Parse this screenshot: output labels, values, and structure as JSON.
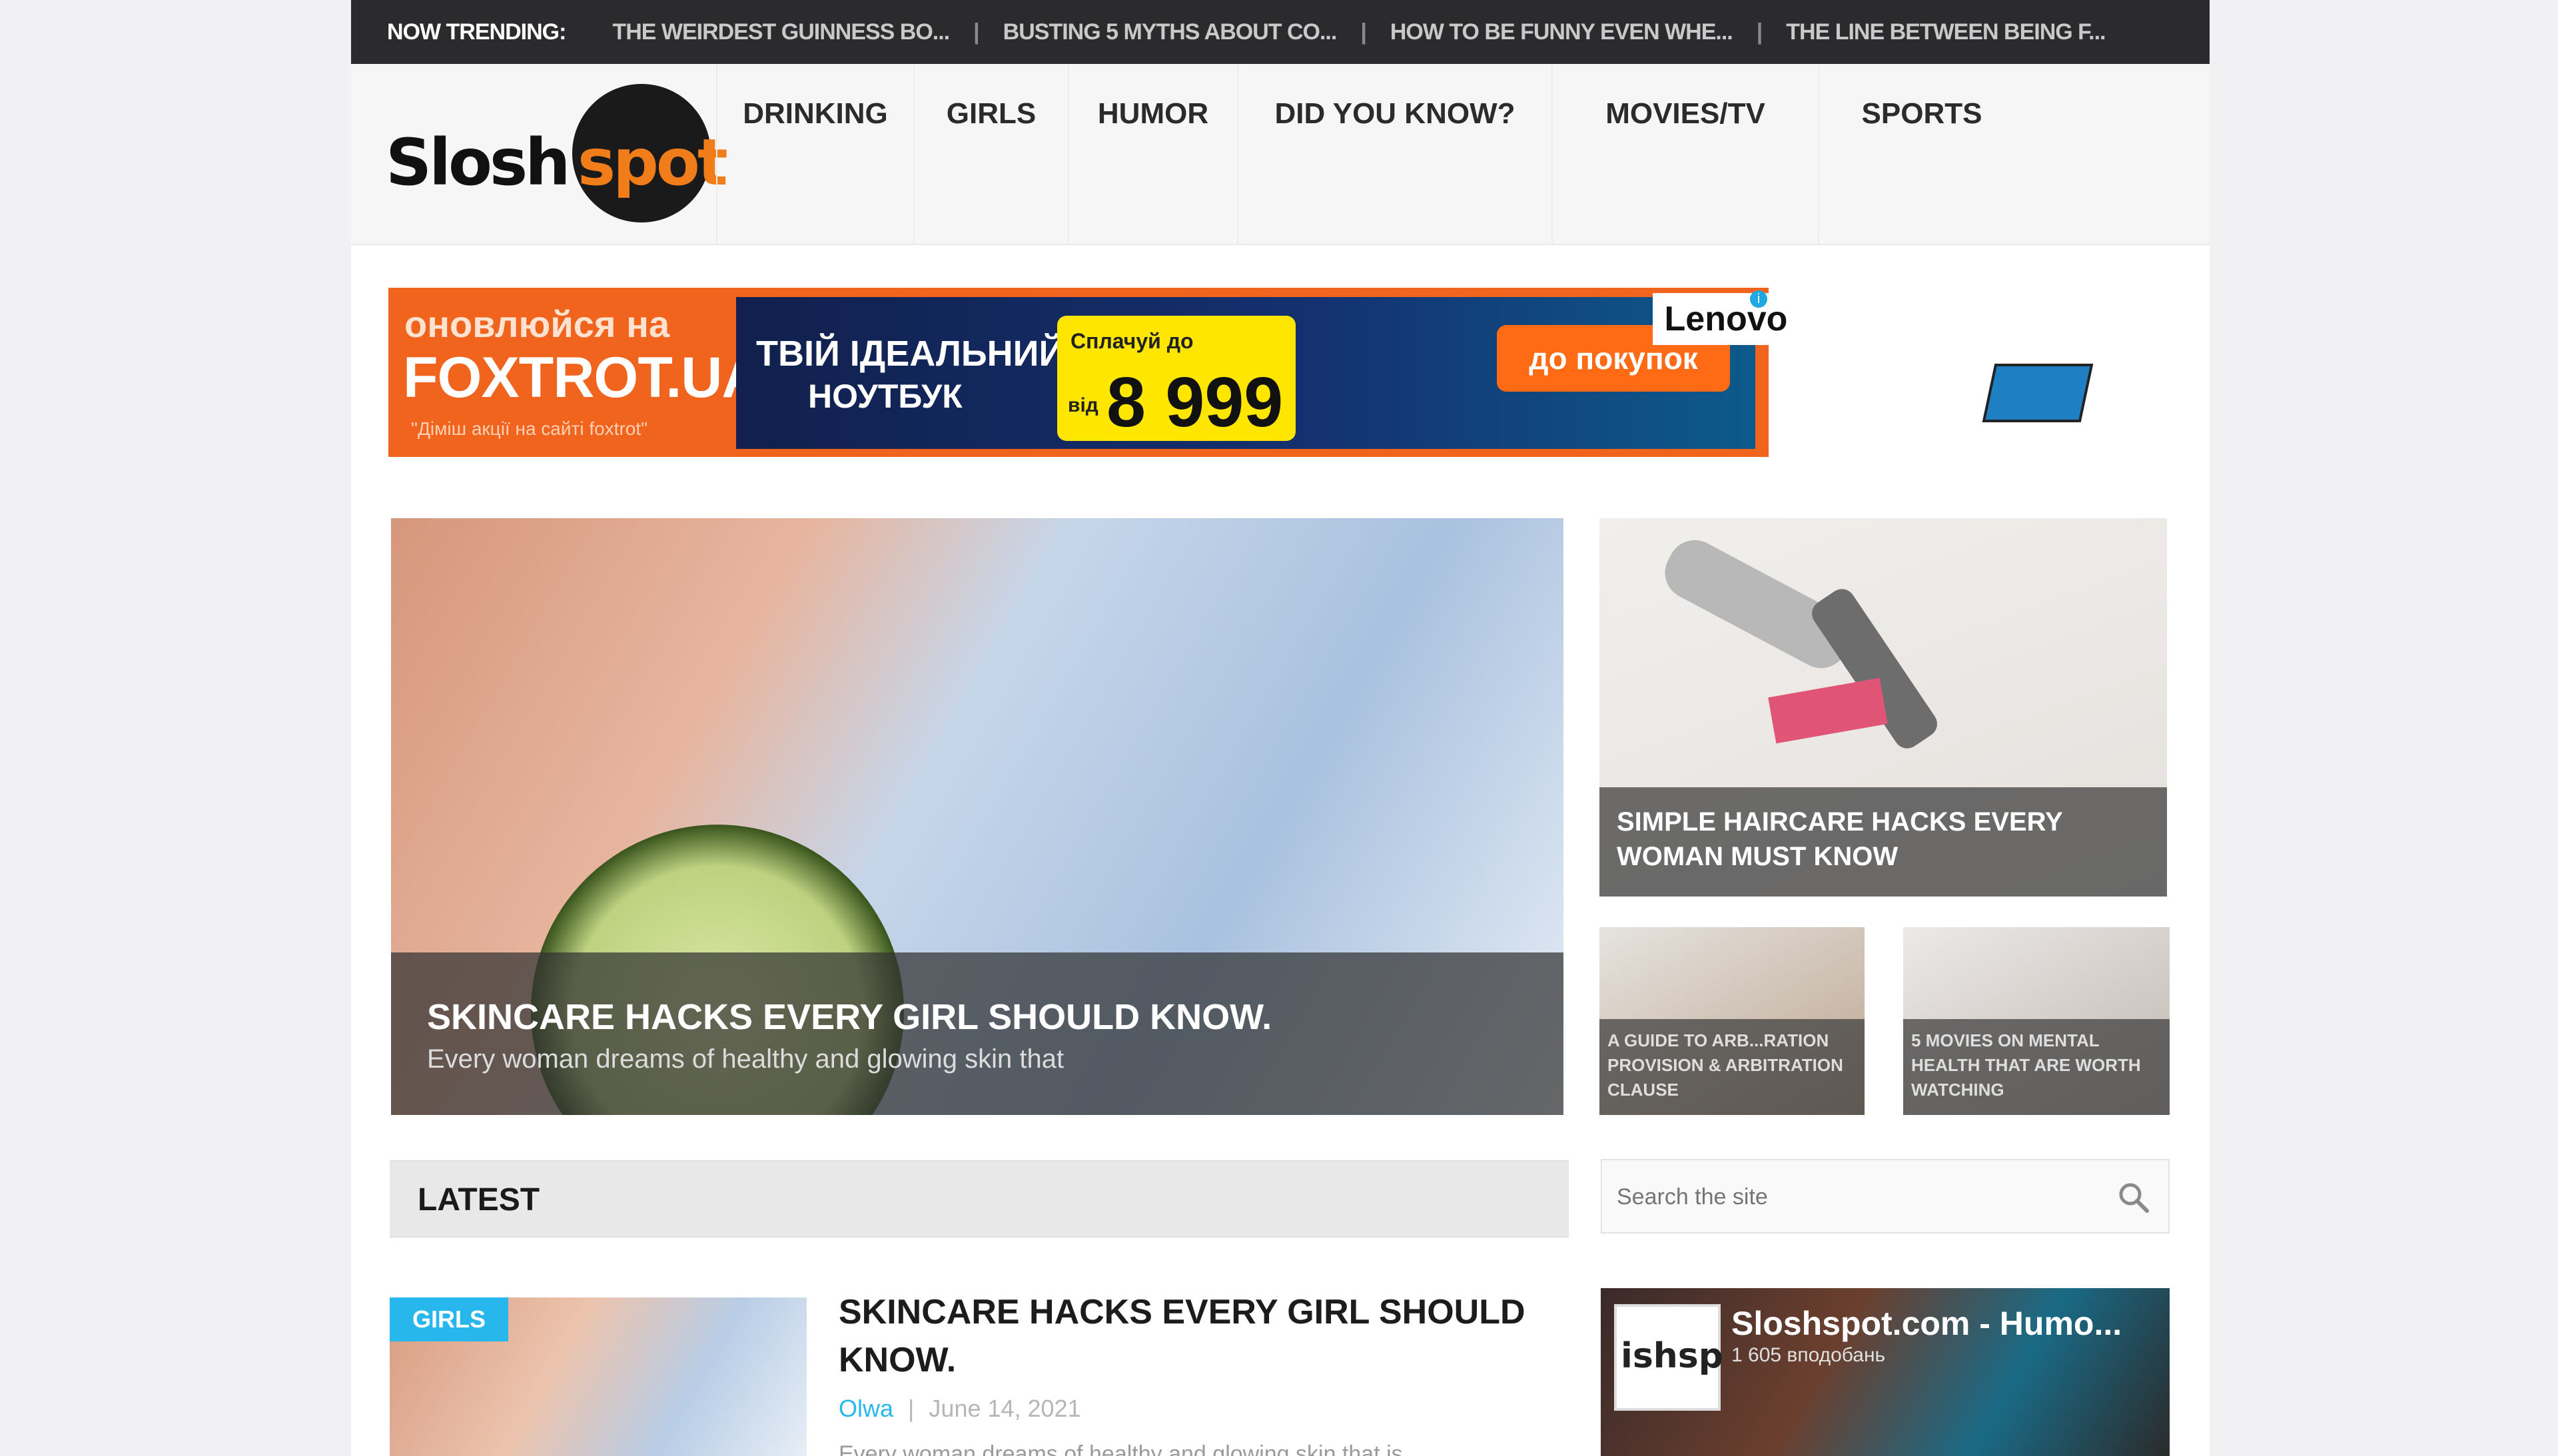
{
  "trending": {
    "label": "NOW TRENDING:",
    "items": [
      "THE WEIRDEST GUINNESS BO...",
      "BUSTING 5 MYTHS ABOUT CO...",
      "HOW TO BE FUNNY EVEN WHE...",
      "THE LINE BETWEEN BEING F..."
    ],
    "separator": "|"
  },
  "logo": {
    "part1": "Slosh",
    "part2": "spot"
  },
  "nav": {
    "items": [
      "DRINKING",
      "GIRLS",
      "HUMOR",
      "DID YOU KNOW?",
      "MOVIES/TV",
      "SPORTS"
    ]
  },
  "ad": {
    "line1": "оновлюйся на",
    "line2": "FOXTROT.UA",
    "line3": "\"Діміш акції на сайті foxtrot\"",
    "headline1": "ТВІЙ ІДЕАЛЬНИЙ",
    "headline2": "НОУТБУК",
    "price_prefix": "Сплачуй до",
    "price_from": "від",
    "price": "8 999",
    "cta": "до покупок",
    "brand": "Lenovo",
    "info_icon": "i",
    "close_icon": "×"
  },
  "hero": {
    "title": "SKINCARE HACKS EVERY GIRL SHOULD KNOW.",
    "excerpt": "Every woman dreams of healthy and glowing skin that"
  },
  "side_card": {
    "title": "SIMPLE HAIRCARE HACKS EVERY WOMAN MUST KNOW"
  },
  "small_cards": [
    {
      "title": "A GUIDE TO ARB...RATION PROVISION & ARBITRATION CLAUSE"
    },
    {
      "title": "5 MOVIES ON MENTAL HEALTH THAT ARE WORTH WATCHING"
    }
  ],
  "latest": {
    "heading": "LATEST"
  },
  "search": {
    "placeholder": "Search the site"
  },
  "post": {
    "category": "GIRLS",
    "title": "SKINCARE HACKS EVERY GIRL SHOULD KNOW.",
    "author": "Olwa",
    "meta_sep": "|",
    "date": "June 14, 2021",
    "excerpt": "Every woman dreams of healthy and glowing skin that is"
  },
  "fb_widget": {
    "avatar_text": "ishsp",
    "name": "Sloshspot.com - Humo...",
    "followers": "1 605 вподобань"
  },
  "colors": {
    "accent_orange": "#f07d1a",
    "accent_blue": "#27b7ec",
    "dark_bar": "#2b2b2d"
  }
}
